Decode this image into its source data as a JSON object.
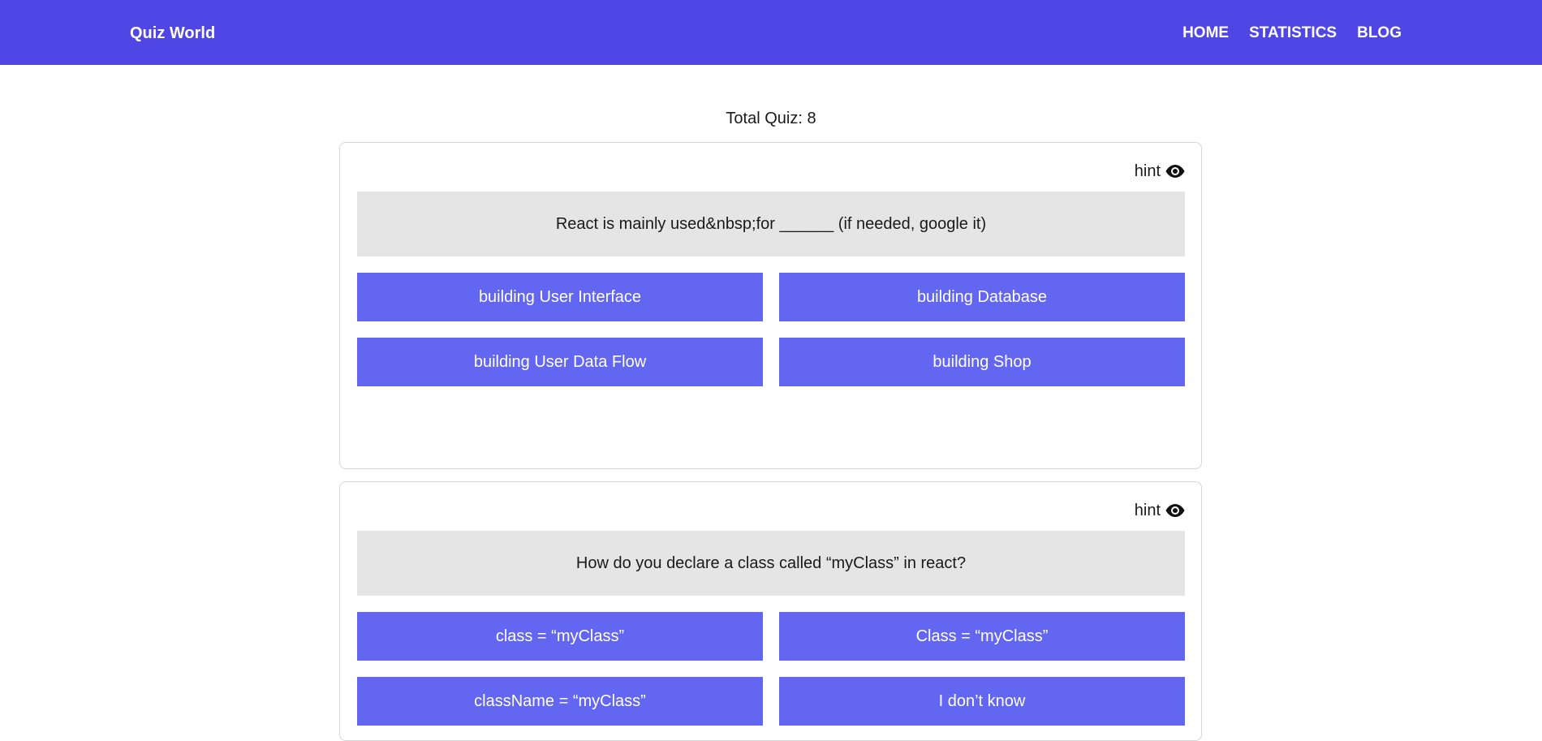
{
  "header": {
    "brand": "Quiz World",
    "nav": [
      "HOME",
      "STATISTICS",
      "BLOG"
    ]
  },
  "summary": {
    "total_label": "Total Quiz: 8"
  },
  "quizzes": [
    {
      "hint_label": "hint",
      "hint_icon": "eye-icon",
      "question": "React is mainly used&nbsp;for ______ (if needed, google it)",
      "options": [
        "building User Interface",
        "building Database",
        "building User Data Flow",
        "building Shop"
      ]
    },
    {
      "hint_label": "hint",
      "hint_icon": "eye-icon",
      "question": "How do you declare a class called “myClass” in react?",
      "options": [
        "class = “myClass”",
        "Class = “myClass”",
        "className = “myClass”",
        "I don’t know"
      ]
    }
  ],
  "colors": {
    "navbar": "#4f46e5",
    "option_button": "#6366f1",
    "question_bg": "#e5e5e5"
  }
}
